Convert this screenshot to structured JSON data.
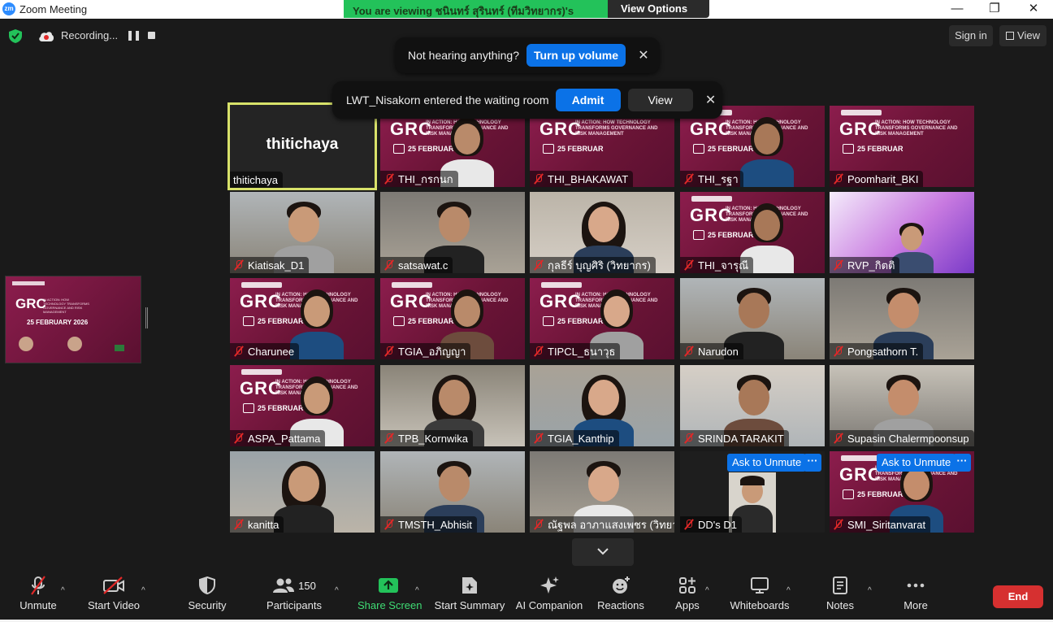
{
  "window": {
    "app_logo": "zm",
    "title": "Zoom Meeting",
    "controls": [
      "—",
      "❐",
      "✕"
    ]
  },
  "share_banner": {
    "text": "You are viewing ชนินทร์ สุรินทร์ (ทีมวิทยากร)'s screen",
    "view_options": "View Options",
    "accent": "#23c25a"
  },
  "topbar": {
    "recording_label": "Recording...",
    "sign_in": "Sign in",
    "view": "View"
  },
  "notifications": {
    "volume": {
      "message": "Not hearing anything?",
      "action": "Turn up volume"
    },
    "waiting_room": {
      "message": "LWT_Nisakorn entered the waiting room",
      "admit": "Admit",
      "view": "View"
    }
  },
  "grc_banner": {
    "logo": "GRC",
    "subtitle": "IN ACTION: HOW TECHNOLOGY TRANSFORMS GOVERNANCE AND RISK MANAGEMENT",
    "date": "25 FEBRUAR",
    "thumb_date": "25 FEBRUARY 2026"
  },
  "participants": [
    {
      "name": "thitichaya",
      "big_label": "thitichaya",
      "muted": false,
      "active_speaker": true,
      "kind": "avatar"
    },
    {
      "name": "THI_กรกนก",
      "muted": true,
      "kind": "grc"
    },
    {
      "name": "THI_BHAKAWAT",
      "muted": true,
      "kind": "grc"
    },
    {
      "name": "THI_รฐา",
      "muted": true,
      "kind": "grc"
    },
    {
      "name": "Poomharit_BKI",
      "muted": true,
      "kind": "grc"
    },
    {
      "name": "Kiatisak_D1",
      "muted": true,
      "kind": "cam"
    },
    {
      "name": "satsawat.c",
      "muted": true,
      "kind": "cam"
    },
    {
      "name": "กุลธีร์ บุญศิริ (วิทยากร)",
      "muted": true,
      "kind": "cam"
    },
    {
      "name": "THI_จารุณี",
      "muted": true,
      "kind": "grc"
    },
    {
      "name": "RVP_กิตติ",
      "muted": true,
      "kind": "purple"
    },
    {
      "name": "Charunee",
      "muted": true,
      "kind": "grc"
    },
    {
      "name": "TGIA_อภิญญา",
      "muted": true,
      "kind": "grc"
    },
    {
      "name": "TIPCL_ธนาวุธ",
      "muted": true,
      "kind": "grc"
    },
    {
      "name": "Narudon",
      "muted": true,
      "kind": "cam"
    },
    {
      "name": "Pongsathorn T.",
      "muted": true,
      "kind": "cam"
    },
    {
      "name": "ASPA_Pattama",
      "muted": true,
      "kind": "grc"
    },
    {
      "name": "TPB_Kornwika",
      "muted": true,
      "kind": "cam"
    },
    {
      "name": "TGIA_Kanthip",
      "muted": true,
      "kind": "cam"
    },
    {
      "name": "SRINDA TARAKIT",
      "muted": true,
      "kind": "cam"
    },
    {
      "name": "Supasin Chalermpoonsup",
      "muted": true,
      "kind": "cam"
    },
    {
      "name": "kanitta",
      "muted": true,
      "kind": "cam"
    },
    {
      "name": "TMSTH_Abhisit",
      "muted": true,
      "kind": "cam"
    },
    {
      "name": "ณัฐพล อาภาแสงเพชร (วิทยา...",
      "muted": true,
      "kind": "cam"
    },
    {
      "name": "DD's D1",
      "muted": true,
      "kind": "dark",
      "ask_unmute": "Ask to Unmute"
    },
    {
      "name": "SMI_Siritanvarat",
      "muted": true,
      "kind": "grc",
      "ask_unmute": "Ask to Unmute"
    }
  ],
  "toolbar": {
    "unmute": "Unmute",
    "start_video": "Start Video",
    "security": "Security",
    "participants": "Participants",
    "participant_count": "150",
    "share_screen": "Share Screen",
    "start_summary": "Start Summary",
    "ai_companion": "AI Companion",
    "reactions": "Reactions",
    "apps": "Apps",
    "whiteboards": "Whiteboards",
    "notes": "Notes",
    "more": "More",
    "end": "End"
  }
}
